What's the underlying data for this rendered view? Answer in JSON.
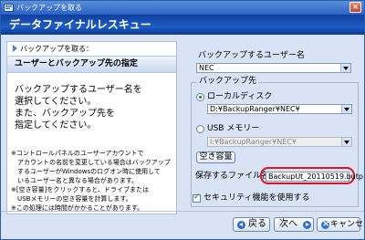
{
  "window": {
    "title": "バックアップを取る",
    "banner_title": "データファイナルレスキュー"
  },
  "left_panel": {
    "heading": "バックアップを取る：",
    "subheading": "ユーザーとバックアップ先の指定",
    "instructions": [
      "バックアップするユーザー名を",
      "選択してください。",
      "また、バックアップ先を",
      "指定してください。"
    ],
    "notes": [
      "※コントロールパネルのユーザーアカウントで",
      "　アカウントの名前を変更している場合はバックアップ",
      "　するユーザーがWindowsのログオン時に使用して",
      "　いるユーザー名と異なる場合があります。",
      "※[空き容量]をクリックすると、ドライブまたは",
      "　USBメモリーの空き容量を計算します。",
      "※この処理には時間がかかることがあります。"
    ]
  },
  "user_select": {
    "label": "バックアップするユーザー名",
    "value": "NEC"
  },
  "destination": {
    "group_label": "バックアップ先",
    "local_disk_label": "ローカルディスク",
    "local_disk_path": "D:¥BackupRanger¥NEC¥",
    "usb_label": "USB メモリー",
    "usb_path": "I:¥BackupRanger¥NEC¥",
    "free_space_button": "空き容量",
    "filename_label": "保存するファイル名:",
    "filename_value": "BackupUt_20110519.butp",
    "selected": "local_disk"
  },
  "security_checkbox": {
    "label": "セキュリティ機能を使用する",
    "checked": true
  },
  "nav": {
    "back": "戻る",
    "next": "次へ",
    "cancel": "キャンセル"
  }
}
